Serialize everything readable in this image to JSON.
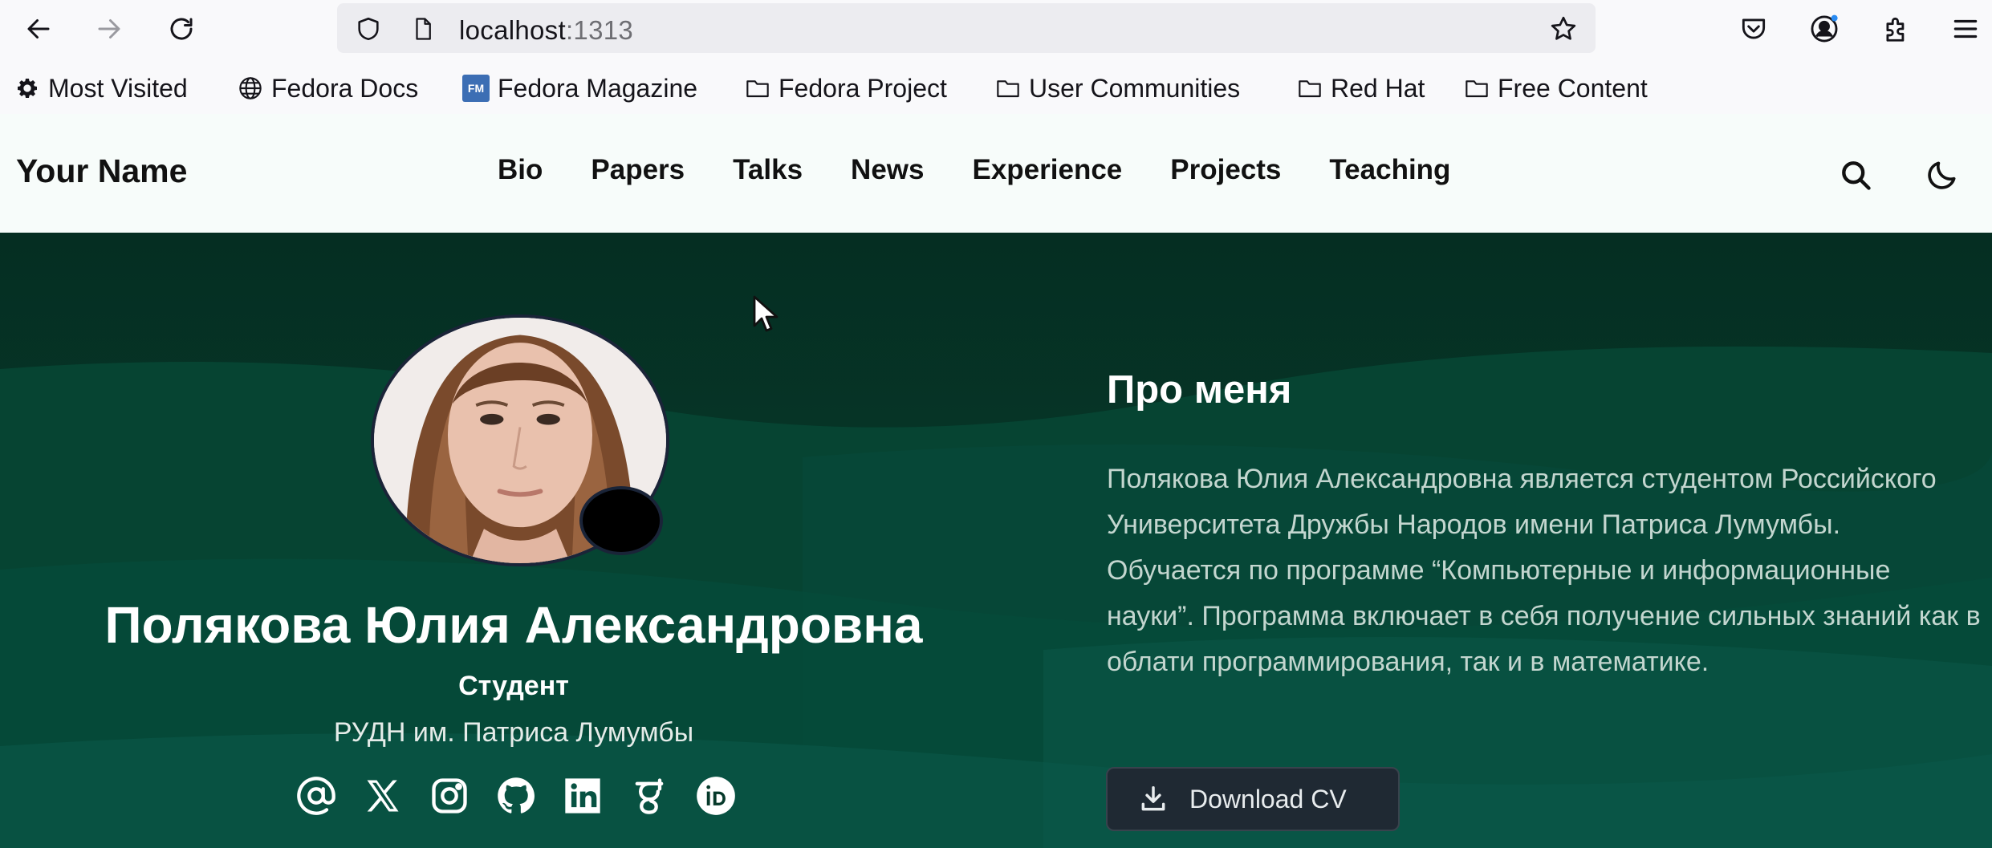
{
  "browser": {
    "url_host": "localhost",
    "url_port": ":1313",
    "bookmarks": [
      {
        "label": "Most Visited",
        "icon": "gear-icon"
      },
      {
        "label": "Fedora Docs",
        "icon": "globe-icon"
      },
      {
        "label": "Fedora Magazine",
        "icon": "fedora-magazine-icon",
        "badge": "FM"
      },
      {
        "label": "Fedora Project",
        "icon": "folder-icon"
      },
      {
        "label": "User Communities",
        "icon": "folder-icon"
      },
      {
        "label": "Red Hat",
        "icon": "folder-icon"
      },
      {
        "label": "Free Content",
        "icon": "folder-icon"
      }
    ]
  },
  "site": {
    "brand": "Your Name",
    "menu": [
      "Bio",
      "Papers",
      "Talks",
      "News",
      "Experience",
      "Projects",
      "Teaching"
    ]
  },
  "profile": {
    "name": "Полякова Юлия Александровна",
    "role": "Студент",
    "organization": "РУДН им. Патриса Лумумбы",
    "socials": [
      "at-sign-icon",
      "x-icon",
      "instagram-icon",
      "github-icon",
      "linkedin-icon",
      "google-scholar-icon",
      "orcid-icon"
    ]
  },
  "about": {
    "title": "Про меня",
    "text": "Полякова Юлия Александровна является студентом Российского Университета Дружбы Народов имени Патриса Лумумбы. Обучается по программе “Компьютерные и информационные науки”. Программа включает в себя получение сильных знаний как в облати программирования, так и в математике.",
    "cv_button": "Download CV"
  },
  "colors": {
    "hero_bg": "#06392a",
    "header_bg": "#f7fcfa",
    "button_bg": "#1f2933"
  }
}
